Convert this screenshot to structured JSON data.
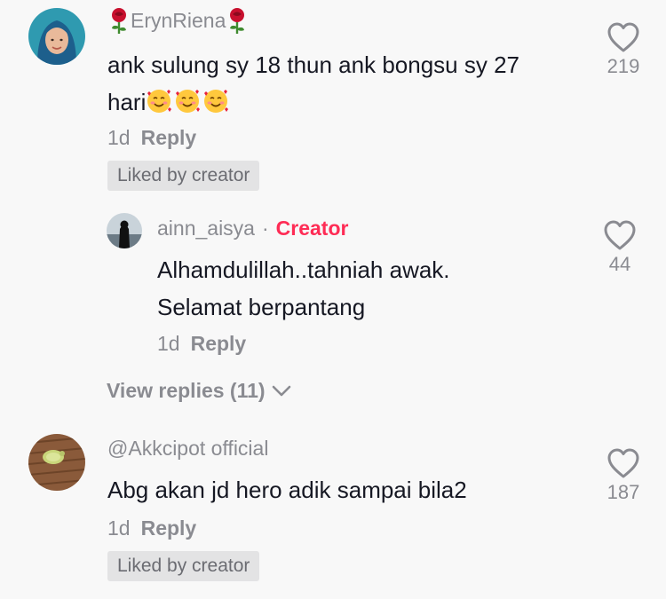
{
  "comments": [
    {
      "username": "ErynRiena",
      "text_line1": "ank sulung sy 18 thun ank bongsu sy 27",
      "text_line2": "hari",
      "time": "1d",
      "reply_label": "Reply",
      "liked_by_creator": "Liked by creator",
      "likes": "219",
      "avatar_icon": "hijab-woman-avatar",
      "name_decoration_icon": "rose-icon",
      "emojis": [
        "smiling-face-with-hearts-emoji",
        "smiling-face-with-hearts-emoji",
        "smiling-face-with-hearts-emoji"
      ],
      "replies": [
        {
          "username": "ainn_aisya",
          "separator": "·",
          "creator_label": "Creator",
          "text_line1": "Alhamdulillah..tahniah awak.",
          "text_line2": "Selamat berpantang",
          "time": "1d",
          "reply_label": "Reply",
          "likes": "44"
        }
      ],
      "view_replies_label": "View replies (11)"
    },
    {
      "username": "@Akkcipot official",
      "text_line1": "Abg akan jd hero adik sampai bila2",
      "time": "1d",
      "reply_label": "Reply",
      "liked_by_creator": "Liked by creator",
      "likes": "187",
      "avatar_icon": "caterpillar-avatar"
    }
  ],
  "colors": {
    "background": "#f8f8f8",
    "text_primary": "#161823",
    "text_secondary": "#8a8b91",
    "creator_accent": "#fe2c55",
    "badge_bg": "#e3e3e4"
  }
}
